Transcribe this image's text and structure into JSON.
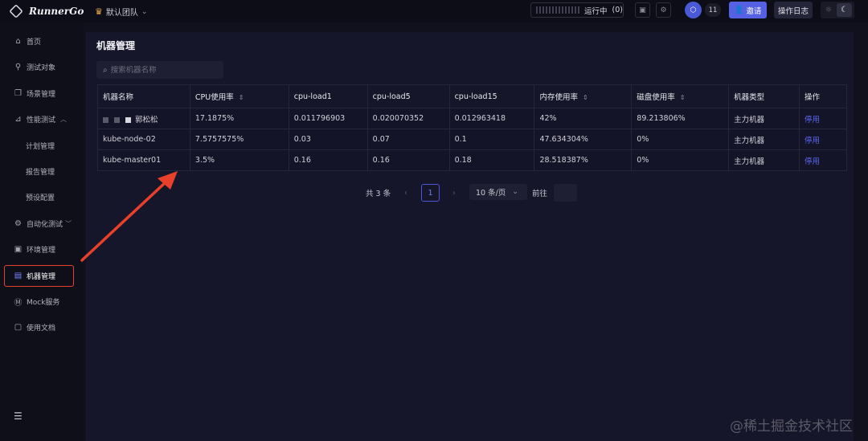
{
  "app": {
    "logo_text": "RunnerGo",
    "team_name": "默认团队"
  },
  "topbar": {
    "running_label": "运行中",
    "running_count": "(0)",
    "user_count": "11",
    "invite_label": "邀请",
    "log_label": "操作日志"
  },
  "sidebar": {
    "items": [
      {
        "label": "首页",
        "icon": "home-icon"
      },
      {
        "label": "测试对象",
        "icon": "link-icon"
      },
      {
        "label": "场景管理",
        "icon": "copy-icon"
      },
      {
        "label": "性能测试",
        "icon": "chart-icon"
      },
      {
        "label": "计划管理"
      },
      {
        "label": "报告管理"
      },
      {
        "label": "预设配置"
      },
      {
        "label": "自动化测试",
        "icon": "gear-icon"
      },
      {
        "label": "环境管理",
        "icon": "env-icon"
      },
      {
        "label": "机器管理",
        "icon": "machine-icon"
      },
      {
        "label": "Mock服务",
        "icon": "mock-icon"
      },
      {
        "label": "使用文档",
        "icon": "doc-icon"
      }
    ]
  },
  "main": {
    "title": "机器管理",
    "search_placeholder": "搜索机器名称",
    "columns": [
      "机器名称",
      "CPU使用率",
      "cpu-load1",
      "cpu-load5",
      "cpu-load15",
      "内存使用率",
      "磁盘使用率",
      "机器类型",
      "操作"
    ],
    "rows": [
      {
        "name": "郭松松",
        "cpu": "17.1875%",
        "load1": "0.011796903",
        "load5": "0.020070352",
        "load15": "0.012963418",
        "mem": "42%",
        "disk": "89.213806%",
        "type": "主力机器",
        "action": "停用"
      },
      {
        "name": "kube-node-02",
        "cpu": "7.5757575%",
        "load1": "0.03",
        "load5": "0.07",
        "load15": "0.1",
        "mem": "47.634304%",
        "disk": "0%",
        "type": "主力机器",
        "action": "停用"
      },
      {
        "name": "kube-master01",
        "cpu": "3.5%",
        "load1": "0.16",
        "load5": "0.16",
        "load15": "0.18",
        "mem": "28.518387%",
        "disk": "0%",
        "type": "主力机器",
        "action": "停用"
      }
    ],
    "pagination": {
      "total": "共 3 条",
      "current_page": "1",
      "page_size": "10 条/页",
      "goto_label": "前往"
    }
  },
  "watermark": "@稀土掘金技术社区",
  "colors": {
    "accent": "#5561e2",
    "highlight_border": "#e8402a",
    "arrow": "#e8402a"
  }
}
